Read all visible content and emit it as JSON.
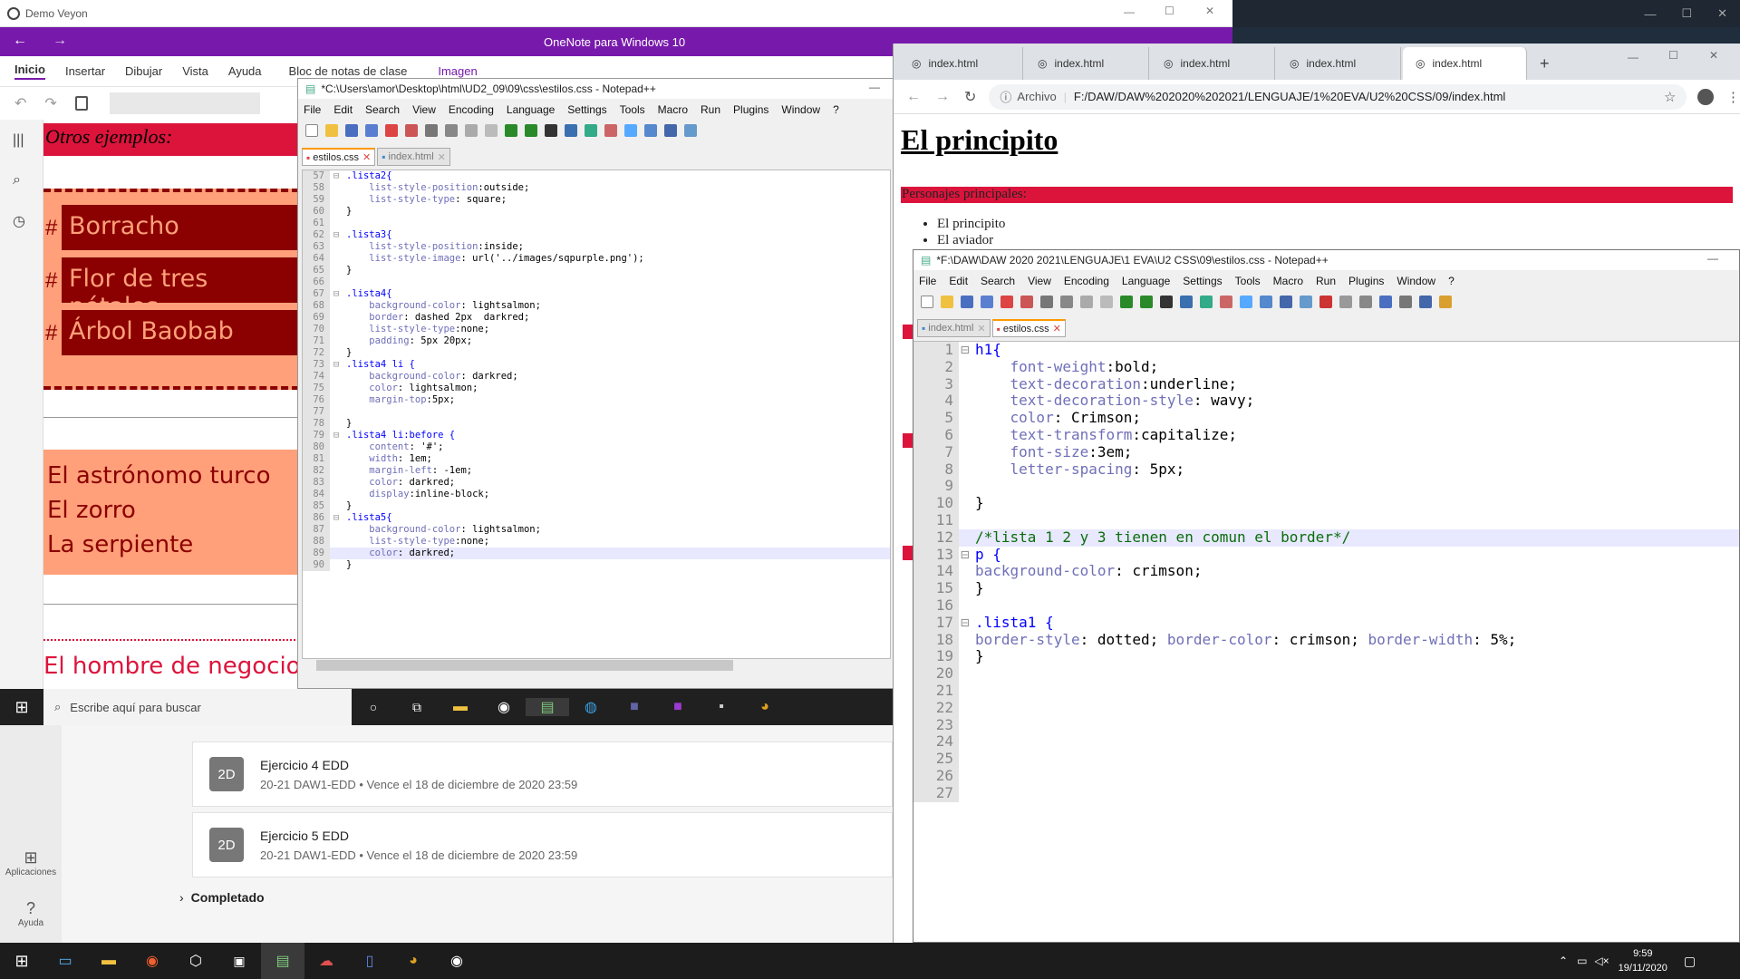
{
  "veyon": {
    "title": "Demo Veyon",
    "btn_min": "—",
    "btn_max": "☐",
    "btn_close": "✕"
  },
  "onenote": {
    "app_title": "OneNote para Windows 10",
    "tabs": [
      "Inicio",
      "Insertar",
      "Dibujar",
      "Vista",
      "Ayuda",
      "Bloc de notas de clase",
      "Imagen"
    ],
    "page": {
      "heading": "Otros ejemplos:",
      "list4": [
        "Borracho",
        "Flor de tres pétalos",
        "Árbol Baobab"
      ],
      "list5": [
        "El astrónomo turco",
        "El zorro",
        "La serpiente"
      ],
      "last": "El hombre de negocio"
    }
  },
  "notepad1": {
    "title": "*C:\\Users\\amor\\Desktop\\html\\UD2_09\\09\\css\\estilos.css - Notepad++",
    "menu": [
      "File",
      "Edit",
      "Search",
      "View",
      "Encoding",
      "Language",
      "Settings",
      "Tools",
      "Macro",
      "Run",
      "Plugins",
      "Window",
      "?"
    ],
    "tabs": [
      "estilos.css",
      "index.html"
    ],
    "lines": [
      {
        "n": "57",
        "t": ".lista2{"
      },
      {
        "n": "58",
        "t": "    list-style-position:outside;"
      },
      {
        "n": "59",
        "t": "    list-style-type: square;"
      },
      {
        "n": "60",
        "t": "}"
      },
      {
        "n": "61",
        "t": ""
      },
      {
        "n": "62",
        "t": ".lista3{"
      },
      {
        "n": "63",
        "t": "    list-style-position:inside;"
      },
      {
        "n": "64",
        "t": "    list-style-image: url('../images/sqpurple.png');"
      },
      {
        "n": "65",
        "t": "}"
      },
      {
        "n": "66",
        "t": ""
      },
      {
        "n": "67",
        "t": ".lista4{"
      },
      {
        "n": "68",
        "t": "    background-color: lightsalmon;"
      },
      {
        "n": "69",
        "t": "    border: dashed 2px  darkred;"
      },
      {
        "n": "70",
        "t": "    list-style-type:none;"
      },
      {
        "n": "71",
        "t": "    padding: 5px 20px;"
      },
      {
        "n": "72",
        "t": "}"
      },
      {
        "n": "73",
        "t": ".lista4 li {"
      },
      {
        "n": "74",
        "t": "    background-color: darkred;"
      },
      {
        "n": "75",
        "t": "    color: lightsalmon;"
      },
      {
        "n": "76",
        "t": "    margin-top:5px;"
      },
      {
        "n": "77",
        "t": ""
      },
      {
        "n": "78",
        "t": "}"
      },
      {
        "n": "79",
        "t": ".lista4 li:before {"
      },
      {
        "n": "80",
        "t": "    content: '#';"
      },
      {
        "n": "81",
        "t": "    width: 1em;"
      },
      {
        "n": "82",
        "t": "    margin-left: -1em;"
      },
      {
        "n": "83",
        "t": "    color: darkred;"
      },
      {
        "n": "84",
        "t": "    display:inline-block;"
      },
      {
        "n": "85",
        "t": "}"
      },
      {
        "n": "86",
        "t": ".lista5{"
      },
      {
        "n": "87",
        "t": "    background-color: lightsalmon;"
      },
      {
        "n": "88",
        "t": "    list-style-type:none;"
      },
      {
        "n": "89",
        "t": "    color: darkred;"
      },
      {
        "n": "90",
        "t": "}"
      }
    ]
  },
  "chrome": {
    "tabs": [
      "index.html",
      "index.html",
      "index.html",
      "index.html",
      "index.html"
    ],
    "new_tab": "+",
    "url_label": "Archivo",
    "url": "F:/DAW/DAW%202020%202021/LENGUAJE/1%20EVA/U2%20CSS/09/index.html",
    "page": {
      "h1": "El principito",
      "p": "Personajes principales:",
      "list1": [
        "El principito",
        "El aviador"
      ]
    }
  },
  "notepad2": {
    "title": "*F:\\DAW\\DAW 2020 2021\\LENGUAJE\\1 EVA\\U2 CSS\\09\\estilos.css - Notepad++",
    "menu": [
      "File",
      "Edit",
      "Search",
      "View",
      "Encoding",
      "Language",
      "Settings",
      "Tools",
      "Macro",
      "Run",
      "Plugins",
      "Window",
      "?"
    ],
    "tabs": [
      "index.html",
      "estilos.css"
    ],
    "lines": [
      {
        "n": "1",
        "t": "h1{"
      },
      {
        "n": "2",
        "t": "    font-weight:bold;"
      },
      {
        "n": "3",
        "t": "    text-decoration:underline;"
      },
      {
        "n": "4",
        "t": "    text-decoration-style: wavy;"
      },
      {
        "n": "5",
        "t": "    color: Crimson;"
      },
      {
        "n": "6",
        "t": "    text-transform:capitalize;"
      },
      {
        "n": "7",
        "t": "    font-size:3em;"
      },
      {
        "n": "8",
        "t": "    letter-spacing: 5px;"
      },
      {
        "n": "9",
        "t": ""
      },
      {
        "n": "10",
        "t": "}"
      },
      {
        "n": "11",
        "t": ""
      },
      {
        "n": "12",
        "t": "/*lista 1 2 y 3 tienen en comun el border*/"
      },
      {
        "n": "13",
        "t": "p {"
      },
      {
        "n": "14",
        "t": "background-color: crimson;"
      },
      {
        "n": "15",
        "t": "}"
      },
      {
        "n": "16",
        "t": ""
      },
      {
        "n": "17",
        "t": ".lista1 {"
      },
      {
        "n": "18",
        "t": "border-style: dotted; border-color: crimson; border-width: 5%;"
      },
      {
        "n": "19",
        "t": "}"
      },
      {
        "n": "20",
        "t": ""
      },
      {
        "n": "21",
        "t": ""
      },
      {
        "n": "22",
        "t": ""
      },
      {
        "n": "23",
        "t": ""
      },
      {
        "n": "24",
        "t": ""
      },
      {
        "n": "25",
        "t": ""
      },
      {
        "n": "26",
        "t": ""
      },
      {
        "n": "27",
        "t": ""
      }
    ]
  },
  "teams": {
    "assignments": [
      {
        "badge": "2D",
        "title": "Ejercicio 4 EDD",
        "course": "20-21 DAW1-EDD",
        "due": "Vence el 18 de diciembre de 2020 23:59"
      },
      {
        "badge": "2D",
        "title": "Ejercicio 5 EDD",
        "course": "20-21 DAW1-EDD",
        "due": "Vence el 18 de diciembre de 2020 23:59"
      }
    ],
    "completed": "Completado",
    "rail": {
      "apps": "Aplicaciones",
      "help": "Ayuda"
    }
  },
  "taskbar": {
    "search_placeholder": "Escribe aquí para buscar",
    "time": "9:59",
    "date": "19/11/2020"
  }
}
